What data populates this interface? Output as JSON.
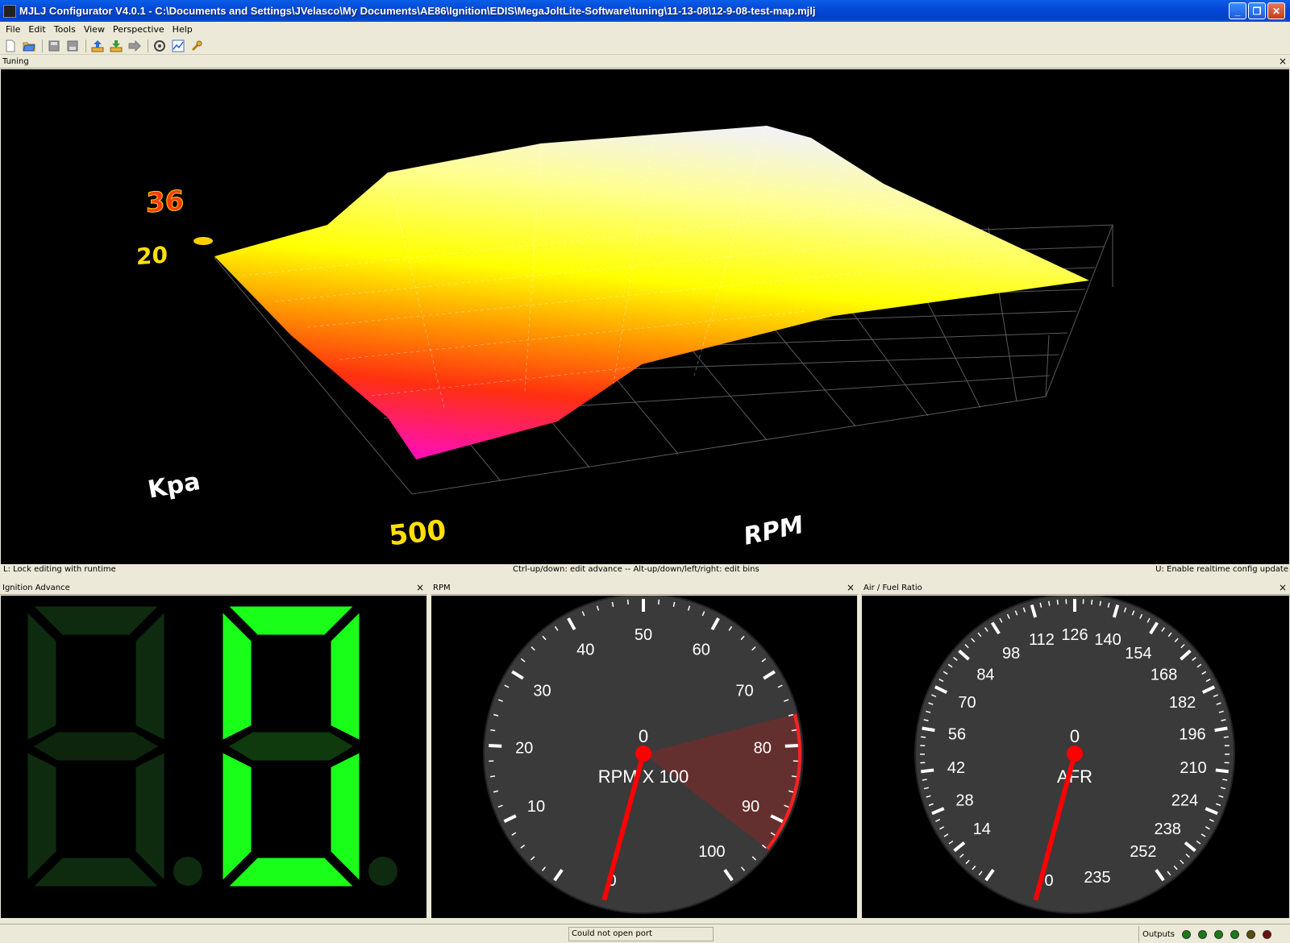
{
  "window": {
    "title": "MJLJ Configurator V4.0.1 - C:\\Documents and Settings\\JVelasco\\My Documents\\AE86\\Ignition\\EDIS\\MegaJoltLite-Software\\tuning\\11-13-08\\12-9-08-test-map.mjlj",
    "minimize": "_",
    "restore": "❐",
    "close": "✕"
  },
  "menu": [
    "File",
    "Edit",
    "Tools",
    "View",
    "Perspective",
    "Help"
  ],
  "toolbar": {
    "icons": [
      "new-file-icon",
      "open-folder-icon",
      "save-icon",
      "save-all-icon",
      "upload-icon",
      "download-icon",
      "forward-icon",
      "config-icon",
      "chart-icon",
      "wrench-icon"
    ]
  },
  "tuning": {
    "title": "Tuning",
    "close": "×",
    "axis": {
      "z_label": "Kpa",
      "x_label": "RPM",
      "z_max_tick": "36",
      "z_min_tick": "20",
      "x_min_tick": "500"
    },
    "status_left": "L: Lock editing with runtime",
    "status_center": "Ctrl-up/down: edit advance -- Alt-up/down/left/right: edit bins",
    "status_right": "U: Enable realtime config update"
  },
  "ignition": {
    "title": "Ignition Advance",
    "close": "×",
    "colors": {
      "off": "#0f2b0f",
      "on": "#1aff1a"
    }
  },
  "rpm": {
    "title": "RPM",
    "close": "×",
    "labels": [
      "10",
      "20",
      "30",
      "40",
      "50",
      "60",
      "70",
      "80",
      "90",
      "100"
    ],
    "bottom_left_label": "0",
    "value": "0",
    "unit": "RPM X 100",
    "colors": {
      "face": "#3c3c3c",
      "needle": "#ff0000",
      "redzone": "#ff2020"
    }
  },
  "afr": {
    "title": "Air / Fuel Ratio",
    "close": "×",
    "labels": [
      "14",
      "28",
      "42",
      "56",
      "70",
      "84",
      "98",
      "112",
      "126",
      "140",
      "154",
      "168",
      "182",
      "196",
      "210",
      "224",
      "238",
      "252"
    ],
    "overlap_label": "235",
    "bottom_left_label": "0",
    "value": "0",
    "unit": "AFR"
  },
  "status": {
    "message": "Could not open port",
    "outputs_label": "Outputs",
    "leds": [
      "#1a7a1a",
      "#1a7a1a",
      "#1a7a1a",
      "#1a7a1a",
      "#5a4a10",
      "#6a1010"
    ]
  }
}
